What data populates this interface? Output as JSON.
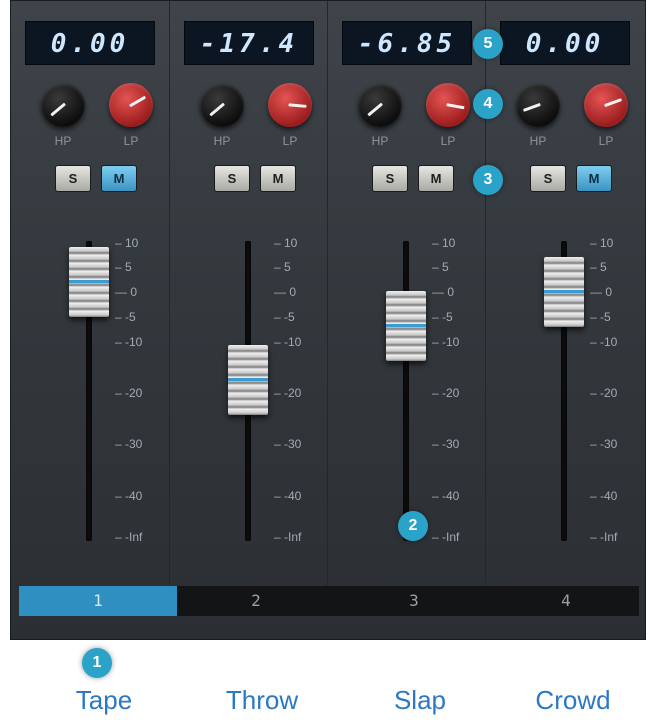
{
  "channels": [
    {
      "readout": "0.00",
      "knob_labels": [
        "HP",
        "LP"
      ],
      "solo": "S",
      "mute": "M",
      "mute_active": true,
      "number": "1",
      "selected": true,
      "fader_db": 2,
      "caption": "Tape"
    },
    {
      "readout": "-17.4",
      "knob_labels": [
        "HP",
        "LP"
      ],
      "solo": "S",
      "mute": "M",
      "mute_active": false,
      "number": "2",
      "selected": false,
      "fader_db": -17.4,
      "caption": "Throw"
    },
    {
      "readout": "-6.85",
      "knob_labels": [
        "HP",
        "LP"
      ],
      "solo": "S",
      "mute": "M",
      "mute_active": false,
      "number": "3",
      "selected": false,
      "fader_db": -6.85,
      "caption": "Slap"
    },
    {
      "readout": "0.00",
      "knob_labels": [
        "HP",
        "LP"
      ],
      "solo": "S",
      "mute": "M",
      "mute_active": true,
      "number": "4",
      "selected": false,
      "fader_db": 0,
      "caption": "Crowd"
    }
  ],
  "scale": [
    "10",
    "5",
    "0",
    "-5",
    "-10",
    "-20",
    "-30",
    "-40",
    "-Inf"
  ],
  "badges": [
    "1",
    "2",
    "3",
    "4",
    "5"
  ],
  "colors": {
    "accent": "#2f8fc1",
    "knob_red": "#c93030",
    "badge": "#2ba3c9",
    "caption": "#2b79c5"
  }
}
